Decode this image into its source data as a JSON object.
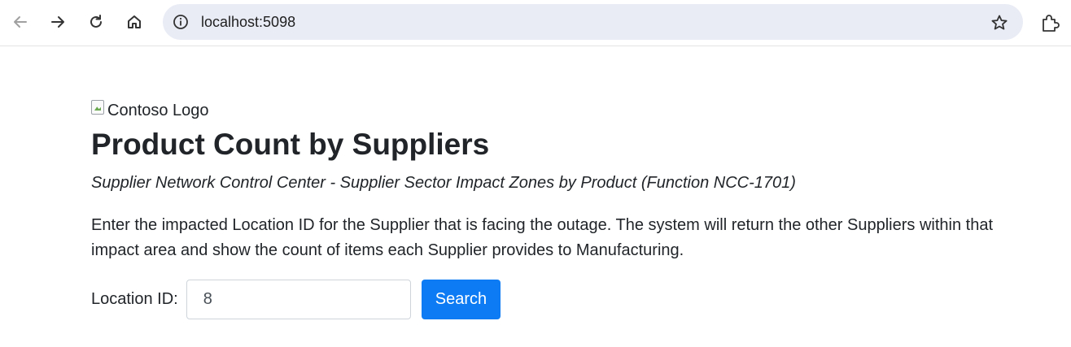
{
  "browser": {
    "url": "localhost:5098",
    "icons": [
      "back-icon",
      "forward-icon",
      "reload-icon",
      "home-icon",
      "site-info-icon",
      "bookmark-star-icon",
      "extensions-icon"
    ]
  },
  "page": {
    "logo_alt": "Contoso Logo",
    "title": "Product Count by Suppliers",
    "subtitle": "Supplier Network Control Center - Supplier Sector Impact Zones by Product (Function NCC-1701)",
    "description": "Enter the impacted Location ID for the Supplier that is facing the outage. The system will return the other Suppliers within that impact area and show the count of items each Supplier provides to Manufacturing.",
    "form": {
      "location_label": "Location ID:",
      "location_value": "8",
      "search_label": "Search"
    }
  },
  "colors": {
    "accent": "#0d7bf3",
    "text": "#212529",
    "omnibox": "#e9ebf5"
  }
}
